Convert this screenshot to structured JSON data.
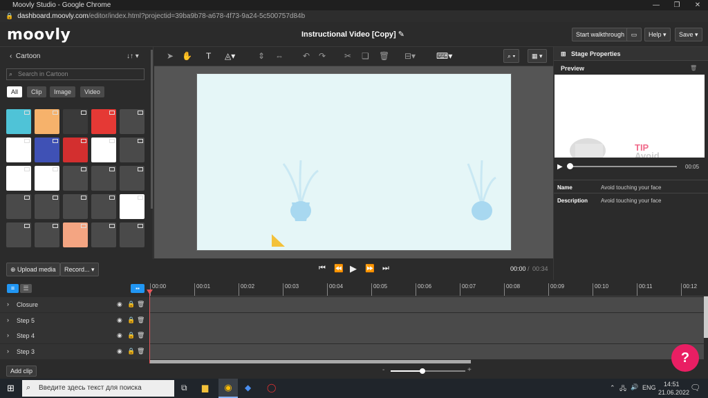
{
  "browser": {
    "window_title": "Moovly Studio - Google Chrome",
    "url_domain": "dashboard.moovly.com",
    "url_path": "/editor/index.html?projectid=39ba9b78-a678-4f73-9a24-5c500757d84b"
  },
  "header": {
    "logo": "moovly",
    "project_title": "Instructional Video [Copy]",
    "walkthrough_label": "Start walkthrough",
    "help_label": "Help ▾",
    "save_label": "Save ▾"
  },
  "library": {
    "title": "Cartoon",
    "search_placeholder": "Search in Cartoon",
    "filters": [
      "All",
      "Clip",
      "Image",
      "Video"
    ],
    "upload_label": "Upload media",
    "record_label": "Record... ▾"
  },
  "playback": {
    "current_time": "00:00",
    "separator": "/",
    "total_time": "00:34"
  },
  "stage_properties": {
    "title": "Stage Properties",
    "preview_label": "Preview",
    "preview_time": "00:05",
    "preview_text_1": "TIP",
    "preview_text_2": "Avoid",
    "name_key": "Name",
    "name_value": "Avoid touching your face",
    "description_key": "Description",
    "description_value": "Avoid touching your face"
  },
  "timeline": {
    "ticks": [
      "00:00",
      "00:01",
      "00:02",
      "00:03",
      "00:04",
      "00:05",
      "00:06",
      "00:07",
      "00:08",
      "00:09",
      "00:10",
      "00:11",
      "00:12"
    ],
    "tracks": [
      "Closure",
      "Step 5",
      "Step 4",
      "Step 3"
    ],
    "add_clip_label": "Add clip",
    "zoom_minus": "-",
    "zoom_plus": "+"
  },
  "help_fab": "?",
  "taskbar": {
    "search_placeholder": "Введите здесь текст для поиска",
    "lang": "ENG",
    "time": "14:51",
    "date": "21.06.2022"
  },
  "colors": {
    "accent_blue": "#2196f3",
    "playhead": "#e8555a",
    "fab": "#e91e63",
    "stage_bg": "#e5f6f7"
  }
}
